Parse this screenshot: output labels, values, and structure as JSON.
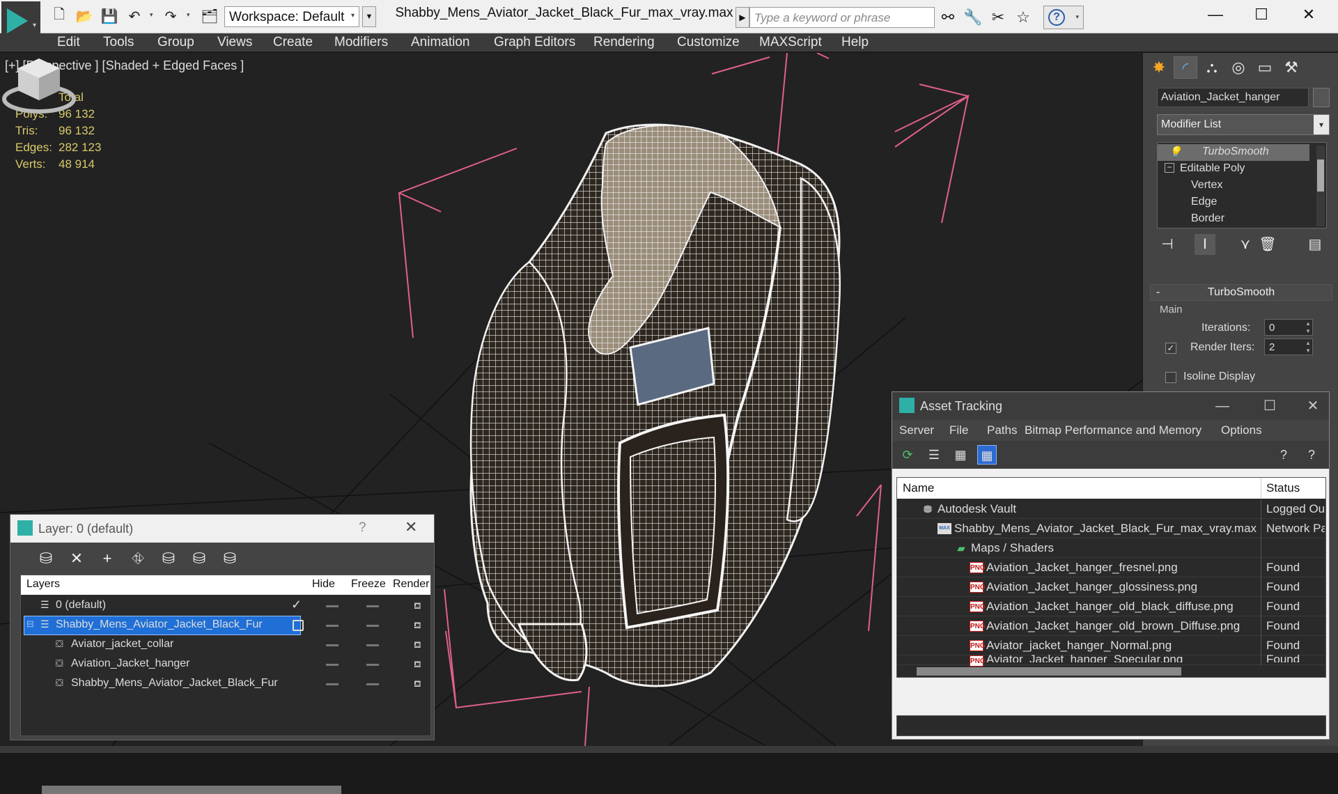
{
  "app": {
    "title": "Shabby_Mens_Aviator_Jacket_Black_Fur_max_vray.max",
    "workspace_label": "Workspace: Default",
    "search_placeholder": "Type a keyword or phrase"
  },
  "menu": [
    "Edit",
    "Tools",
    "Group",
    "Views",
    "Create",
    "Modifiers",
    "Animation",
    "Graph Editors",
    "Rendering",
    "Customize",
    "MAXScript",
    "Help"
  ],
  "viewport": {
    "label": "[+] [Perspective ] [Shaded + Edged Faces ]",
    "stats": {
      "header": "Total",
      "rows": [
        {
          "label": "Polys:",
          "value": "96 132"
        },
        {
          "label": "Tris:",
          "value": "96 132"
        },
        {
          "label": "Edges:",
          "value": "282 123"
        },
        {
          "label": "Verts:",
          "value": "48 914"
        }
      ]
    }
  },
  "command_panel": {
    "object_name": "Aviation_Jacket_hanger",
    "modifier_list": "Modifier List",
    "stack": [
      "TurboSmooth",
      "Editable Poly",
      "Vertex",
      "Edge",
      "Border"
    ],
    "turbosmooth": {
      "title": "TurboSmooth",
      "main": "Main",
      "iterations_label": "Iterations:",
      "iterations_value": "0",
      "render_iters_label": "Render Iters:",
      "render_iters_value": "2",
      "isoline_label": "Isoline Display"
    }
  },
  "layer_window": {
    "title": "Layer: 0 (default)",
    "columns": {
      "layers": "Layers",
      "hide": "Hide",
      "freeze": "Freeze",
      "render": "Render"
    },
    "rows": [
      {
        "name": "0 (default)",
        "indent": 0
      },
      {
        "name": "Shabby_Mens_Aviator_Jacket_Black_Fur",
        "indent": 0
      },
      {
        "name": "Aviator_jacket_collar",
        "indent": 1
      },
      {
        "name": "Aviation_Jacket_hanger",
        "indent": 1
      },
      {
        "name": "Shabby_Mens_Aviator_Jacket_Black_Fur",
        "indent": 1
      }
    ]
  },
  "asset_window": {
    "title": "Asset Tracking",
    "menu": [
      "Server",
      "File",
      "Paths",
      "Bitmap Performance and Memory",
      "Options"
    ],
    "columns": {
      "name": "Name",
      "status": "Status"
    },
    "rows": [
      {
        "name": "Autodesk Vault",
        "status": "Logged Ou",
        "indent": 0
      },
      {
        "name": "Shabby_Mens_Aviator_Jacket_Black_Fur_max_vray.max",
        "status": "Network Pa",
        "indent": 1
      },
      {
        "name": "Maps / Shaders",
        "status": "",
        "indent": 2
      },
      {
        "name": "Aviation_Jacket_hanger_fresnel.png",
        "status": "Found",
        "indent": 3
      },
      {
        "name": "Aviation_Jacket_hanger_glossiness.png",
        "status": "Found",
        "indent": 3
      },
      {
        "name": "Aviation_Jacket_hanger_old_black_diffuse.png",
        "status": "Found",
        "indent": 3
      },
      {
        "name": "Aviation_Jacket_hanger_old_brown_Diffuse.png",
        "status": "Found",
        "indent": 3
      },
      {
        "name": "Aviator_jacket_hanger_Normal.png",
        "status": "Found",
        "indent": 3
      },
      {
        "name": "Aviator_Jacket_hanger_Specular.png",
        "status": "Found",
        "indent": 3
      }
    ]
  },
  "colors": {
    "accent": "#2fb0a6",
    "selection": "#1f6fd6",
    "stats_text": "#d8c96a",
    "gizmo": "#e0608c"
  }
}
